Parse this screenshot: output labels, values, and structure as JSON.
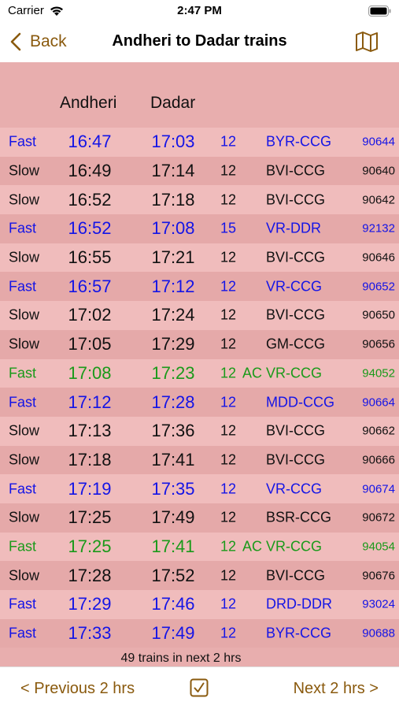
{
  "status_bar": {
    "carrier": "Carrier",
    "time": "2:47 PM"
  },
  "nav": {
    "back_label": "Back",
    "title": "Andheri to Dadar trains"
  },
  "columns": {
    "from": "Andheri",
    "to": "Dadar"
  },
  "colors": {
    "fast": "#1414e6",
    "slow": "#111111",
    "ac": "#1a9a1a",
    "accent": "#8a5a0e"
  },
  "trains": [
    {
      "type": "Fast",
      "dep": "16:47",
      "arr": "17:03",
      "cars": "12",
      "ac": "",
      "route": "BYR-CCG",
      "num": "90644",
      "kind": "fast"
    },
    {
      "type": "Slow",
      "dep": "16:49",
      "arr": "17:14",
      "cars": "12",
      "ac": "",
      "route": "BVI-CCG",
      "num": "90640",
      "kind": "slow"
    },
    {
      "type": "Slow",
      "dep": "16:52",
      "arr": "17:18",
      "cars": "12",
      "ac": "",
      "route": "BVI-CCG",
      "num": "90642",
      "kind": "slow"
    },
    {
      "type": "Fast",
      "dep": "16:52",
      "arr": "17:08",
      "cars": "15",
      "ac": "",
      "route": "VR-DDR",
      "num": "92132",
      "kind": "fast"
    },
    {
      "type": "Slow",
      "dep": "16:55",
      "arr": "17:21",
      "cars": "12",
      "ac": "",
      "route": "BVI-CCG",
      "num": "90646",
      "kind": "slow"
    },
    {
      "type": "Fast",
      "dep": "16:57",
      "arr": "17:12",
      "cars": "12",
      "ac": "",
      "route": "VR-CCG",
      "num": "90652",
      "kind": "fast"
    },
    {
      "type": "Slow",
      "dep": "17:02",
      "arr": "17:24",
      "cars": "12",
      "ac": "",
      "route": "BVI-CCG",
      "num": "90650",
      "kind": "slow"
    },
    {
      "type": "Slow",
      "dep": "17:05",
      "arr": "17:29",
      "cars": "12",
      "ac": "",
      "route": "GM-CCG",
      "num": "90656",
      "kind": "slow"
    },
    {
      "type": "Fast",
      "dep": "17:08",
      "arr": "17:23",
      "cars": "12",
      "ac": "AC",
      "route": "VR-CCG",
      "num": "94052",
      "kind": "ac"
    },
    {
      "type": "Fast",
      "dep": "17:12",
      "arr": "17:28",
      "cars": "12",
      "ac": "",
      "route": "MDD-CCG",
      "num": "90664",
      "kind": "fast"
    },
    {
      "type": "Slow",
      "dep": "17:13",
      "arr": "17:36",
      "cars": "12",
      "ac": "",
      "route": "BVI-CCG",
      "num": "90662",
      "kind": "slow"
    },
    {
      "type": "Slow",
      "dep": "17:18",
      "arr": "17:41",
      "cars": "12",
      "ac": "",
      "route": "BVI-CCG",
      "num": "90666",
      "kind": "slow"
    },
    {
      "type": "Fast",
      "dep": "17:19",
      "arr": "17:35",
      "cars": "12",
      "ac": "",
      "route": "VR-CCG",
      "num": "90674",
      "kind": "fast"
    },
    {
      "type": "Slow",
      "dep": "17:25",
      "arr": "17:49",
      "cars": "12",
      "ac": "",
      "route": "BSR-CCG",
      "num": "90672",
      "kind": "slow"
    },
    {
      "type": "Fast",
      "dep": "17:25",
      "arr": "17:41",
      "cars": "12",
      "ac": "AC",
      "route": "VR-CCG",
      "num": "94054",
      "kind": "ac"
    },
    {
      "type": "Slow",
      "dep": "17:28",
      "arr": "17:52",
      "cars": "12",
      "ac": "",
      "route": "BVI-CCG",
      "num": "90676",
      "kind": "slow"
    },
    {
      "type": "Fast",
      "dep": "17:29",
      "arr": "17:46",
      "cars": "12",
      "ac": "",
      "route": "DRD-DDR",
      "num": "93024",
      "kind": "fast"
    },
    {
      "type": "Fast",
      "dep": "17:33",
      "arr": "17:49",
      "cars": "12",
      "ac": "",
      "route": "BYR-CCG",
      "num": "90688",
      "kind": "fast"
    }
  ],
  "footer": {
    "count_text": "49 trains in next 2 hrs"
  },
  "toolbar": {
    "prev_label": "< Previous 2 hrs",
    "next_label": "Next 2 hrs >"
  },
  "icons": {
    "wifi": "wifi-icon",
    "battery": "battery-icon",
    "back": "chevron-left-icon",
    "map": "map-icon",
    "check": "checkbox-icon"
  }
}
